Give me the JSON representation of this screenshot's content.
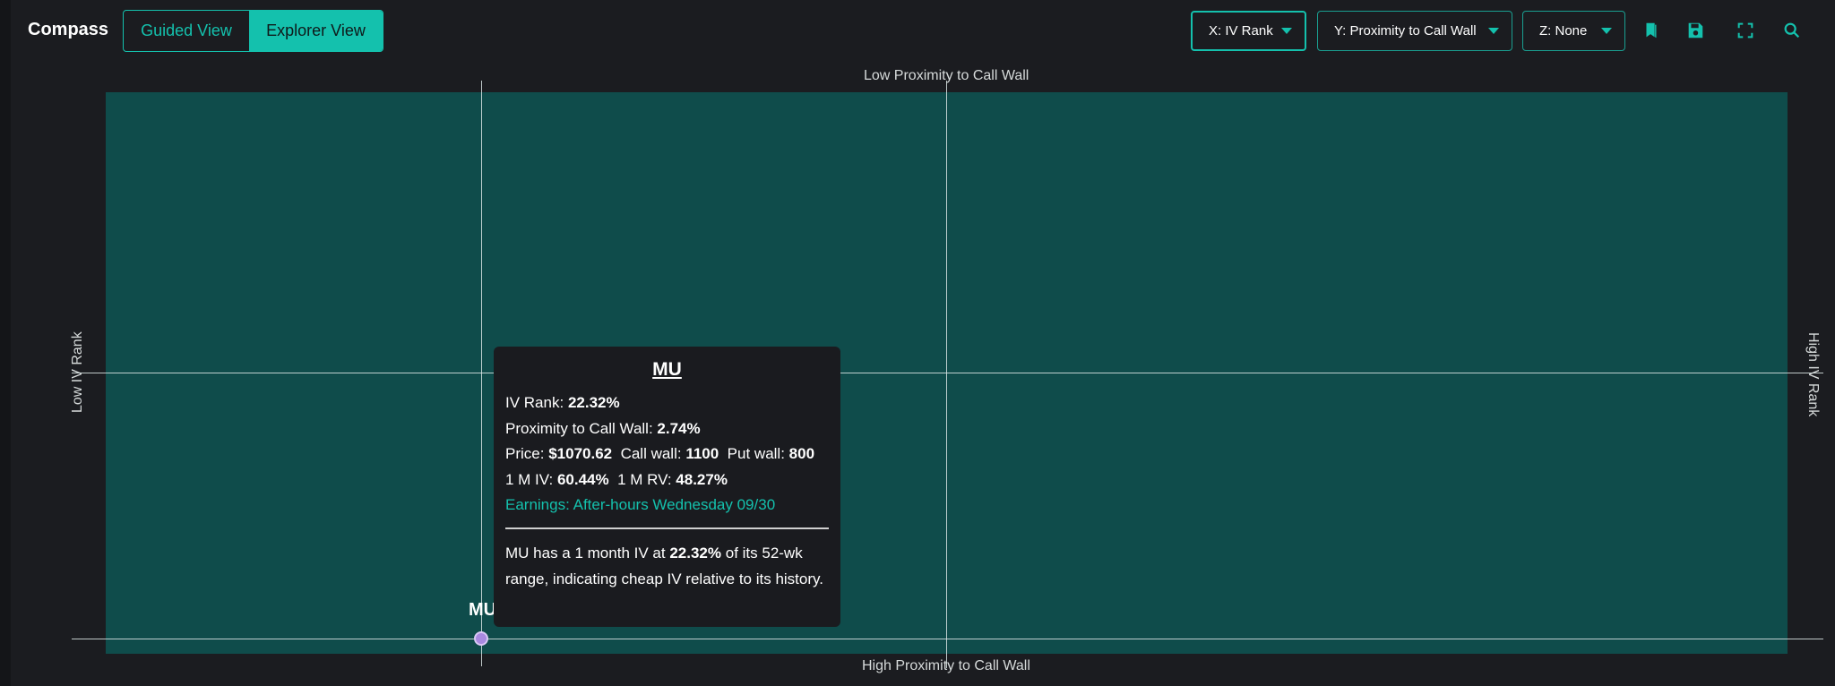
{
  "app": {
    "brand": "Compass"
  },
  "view_toggle": {
    "guided_label": "Guided View",
    "explorer_label": "Explorer View",
    "active": "Explorer View"
  },
  "axis_selectors": {
    "x_label": "X: IV Rank",
    "y_label": "Y: Proximity to Call Wall",
    "z_label": "Z: None"
  },
  "toolbar_icons": [
    "bookmarks-icon",
    "save-icon",
    "fullscreen-icon",
    "zoom-icon"
  ],
  "colors": {
    "accent": "#14c1ad",
    "plot_background": "#0f4c4b",
    "page_background": "#1b1c20",
    "point": "#a889e0"
  },
  "chart_data": {
    "type": "scatter",
    "axis_labels": {
      "top": "Low Proximity to Call Wall",
      "bottom": "High Proximity to Call Wall",
      "left": "Low IV Rank",
      "right": "High IV Rank"
    },
    "xlim": [
      0,
      100
    ],
    "ylim": [
      0,
      100
    ],
    "points": [
      {
        "label": "MU",
        "x": 22.32,
        "y": 2.74
      }
    ]
  },
  "tooltip": {
    "symbol": "MU",
    "iv_rank_label": "IV Rank:",
    "iv_rank_value": "22.32%",
    "proximity_label": "Proximity to Call Wall:",
    "proximity_value": "2.74%",
    "price_label": "Price:",
    "price_value": "$1070.62",
    "call_wall_label": "Call wall:",
    "call_wall_value": "1100",
    "put_wall_label": "Put wall:",
    "put_wall_value": "800",
    "iv_1m_label": "1 M IV:",
    "iv_1m_value": "60.44%",
    "rv_1m_label": "1 M RV:",
    "rv_1m_value": "48.27%",
    "earnings": "Earnings: After-hours Wednesday 09/30",
    "desc_before": "MU has a 1 month IV at",
    "desc_value": "22.32%",
    "desc_after": "of its 52-wk range, indicating cheap IV relative to its history."
  }
}
